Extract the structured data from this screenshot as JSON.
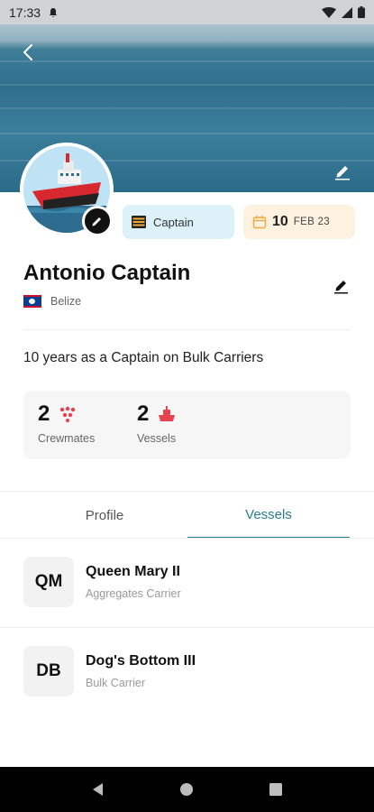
{
  "status_bar": {
    "time": "17:33"
  },
  "profile": {
    "role": "Captain",
    "date_day": "10",
    "date_month_year": "FEB 23",
    "name": "Antonio Captain",
    "country": "Belize",
    "bio": "10 years as a Captain on Bulk Carriers"
  },
  "stats": [
    {
      "value": "2",
      "label": "Crewmates"
    },
    {
      "value": "2",
      "label": "Vessels"
    }
  ],
  "tabs": [
    {
      "label": "Profile",
      "active": false
    },
    {
      "label": "Vessels",
      "active": true
    }
  ],
  "vessels": [
    {
      "abbr": "QM",
      "name": "Queen Mary II",
      "type": "Aggregates Carrier"
    },
    {
      "abbr": "DB",
      "name": "Dog's Bottom III",
      "type": "Bulk Carrier"
    }
  ],
  "colors": {
    "accent": "#2a7f8c",
    "stat_icon": "#e8414f",
    "role_chip": "#dcf1f8",
    "date_chip": "#fdf1df"
  }
}
